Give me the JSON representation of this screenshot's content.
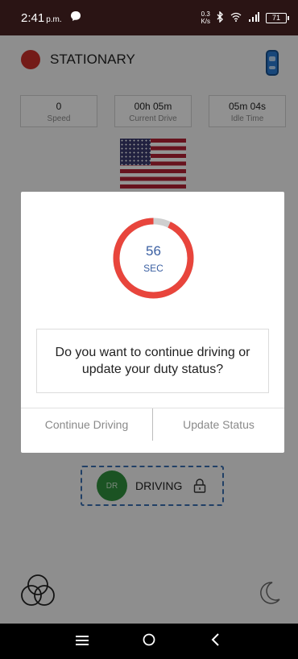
{
  "status_bar": {
    "time": "2:41",
    "ampm": "p.m.",
    "net_speed_top": "0.3",
    "net_speed_bottom": "K/s",
    "battery": "71"
  },
  "app": {
    "status_label": "STATIONARY",
    "stats": [
      {
        "value": "0",
        "label": "Speed"
      },
      {
        "value": "00h 05m",
        "label": "Current Drive"
      },
      {
        "value": "05m 04s",
        "label": "Idle Time"
      }
    ],
    "driving_badge": "DR",
    "driving_label": "DRIVING"
  },
  "dialog": {
    "countdown": "56",
    "countdown_unit": "SEC",
    "countdown_fraction_remaining": 0.93,
    "question": "Do you want to continue driving or update your duty status?",
    "continue_label": "Continue Driving",
    "update_label": "Update Status"
  },
  "colors": {
    "ring_active": "#e8453c",
    "ring_track": "#cfcfcf",
    "accent_text": "#3a5fa2"
  }
}
